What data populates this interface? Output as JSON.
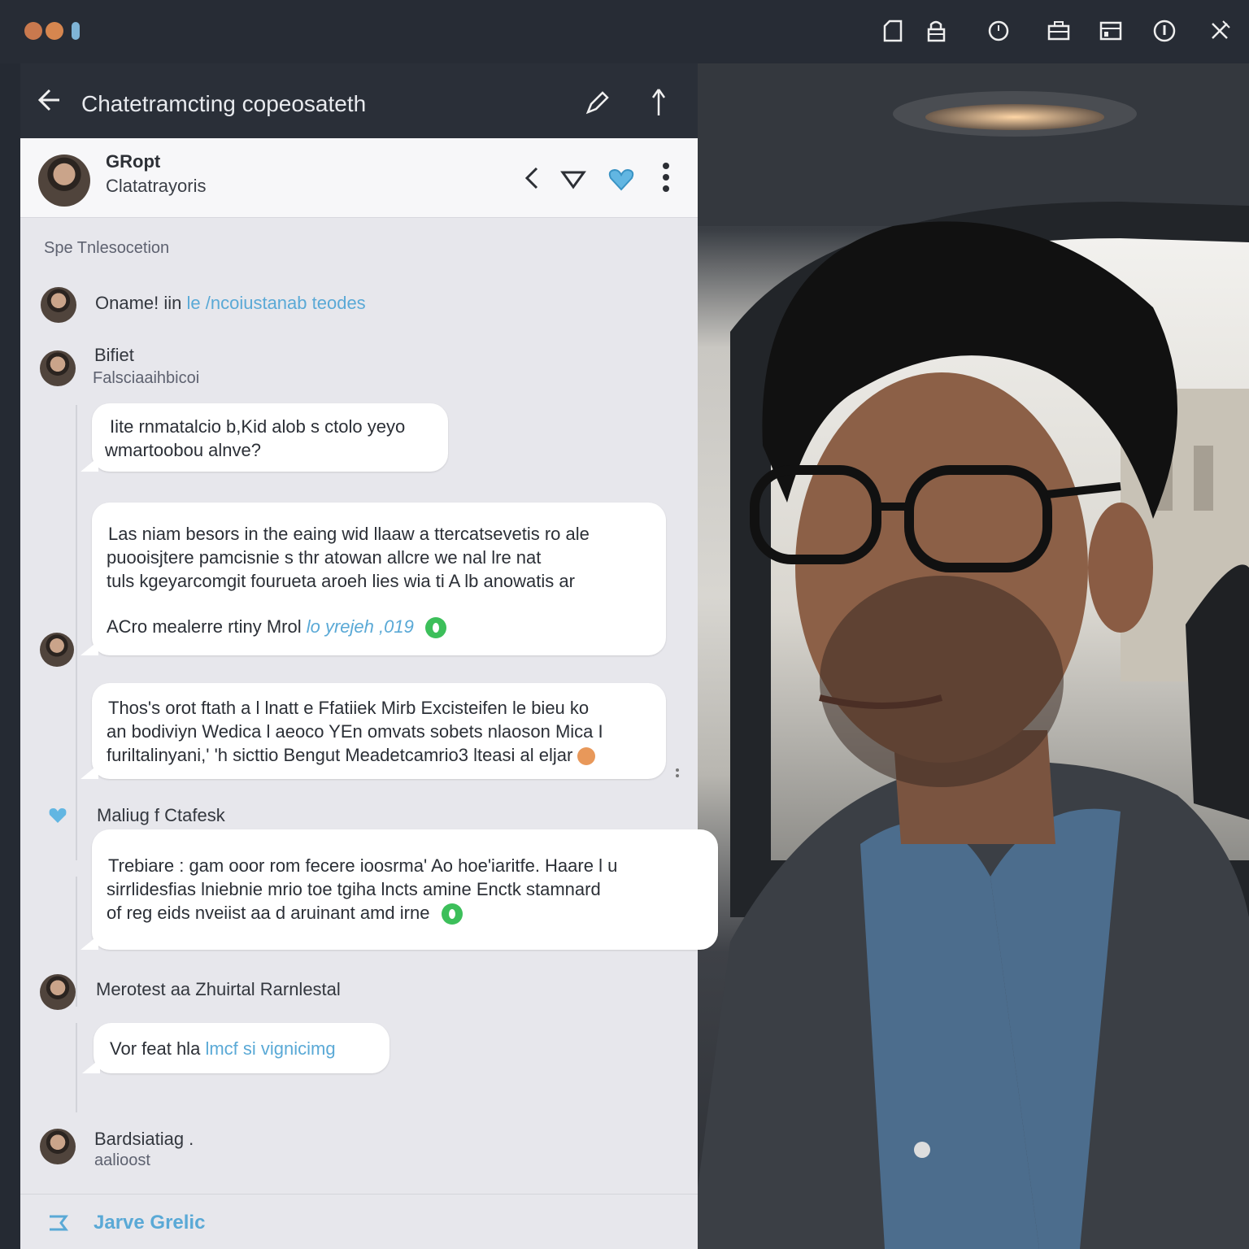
{
  "header": {
    "title": "Chatetramcting copeosateth"
  },
  "contact": {
    "name": "GRopt",
    "status": "Clatatrayoris"
  },
  "section": {
    "label": "Spe Tnlesocetion"
  },
  "feed": {
    "item1": {
      "prefix": "Oname! iin",
      "link": "le /ncoiustanab teodes"
    },
    "item2": {
      "name": "Bifiet",
      "sub": "Falsciaaihbicoi"
    },
    "bubble1": {
      "line1": "Iite rnmatalcio b,Kid alob s ctolo yeyo",
      "line2": "wmartoobou alnve?"
    },
    "bubble2": {
      "line1": "Las niam besors in the eaing wid llaaw a ttercatsevetis ro ale",
      "line2": "puooisjtere pamcisnie s thr atowan allcre we nal lre nat",
      "line3": "tuls kgeyarcomgit fourueta aroeh lies wia ti A lb anowatis ar",
      "line4": "ACro mealerre rtiny Mrol",
      "link": "lo yrejeh ,019"
    },
    "bubble3": {
      "line1": "Thos's orot ftath a l lnatt e Ffatiiek Mirb Excisteifen le bieu ko",
      "line2": "an bodiviyn Wedica l aeoco YEn omvats sobets nlaoson Mica I",
      "line3": "furiltalinyani,' 'h sicttio Bengut Meadetcamrio3 lteasi al eljar"
    },
    "item3": {
      "name": "Maliug f Ctafesk"
    },
    "bubble4": {
      "line1": "Trebiare : gam ooor rom fecere ioosrma' Ao hoe'iaritfe. Haare l u",
      "line2": "sirrlidesfias lniebnie mrio toe tgiha lncts amine Enctk stamnard",
      "line3": "of reg eids nveiist aa d aruinant amd irne"
    },
    "item4": {
      "name": "Merotest aa Zhuirtal Rarnlestal"
    },
    "bubble5": {
      "text": "Vor feat hla",
      "link": "lmcf si vignicimg"
    },
    "item5": {
      "name": "Bardsiatiag .",
      "sub": "aalioost"
    }
  },
  "footer": {
    "label": "Jarve Grelic"
  },
  "colors": {
    "accent": "#5aa9d6",
    "green": "#3cbf5a",
    "header_bg": "#2a2f38",
    "panel_bg": "#e7e7ec"
  },
  "icons": {
    "topbar": [
      "home-icon",
      "lock-icon",
      "clock-icon",
      "briefcase-icon",
      "card-icon",
      "info-icon",
      "close-icon"
    ],
    "header": [
      "back-arrow-icon",
      "pen-icon",
      "share-icon"
    ],
    "contact": [
      "chevron-left-icon",
      "triangle-down-icon",
      "heart-icon",
      "more-vertical-icon"
    ]
  }
}
